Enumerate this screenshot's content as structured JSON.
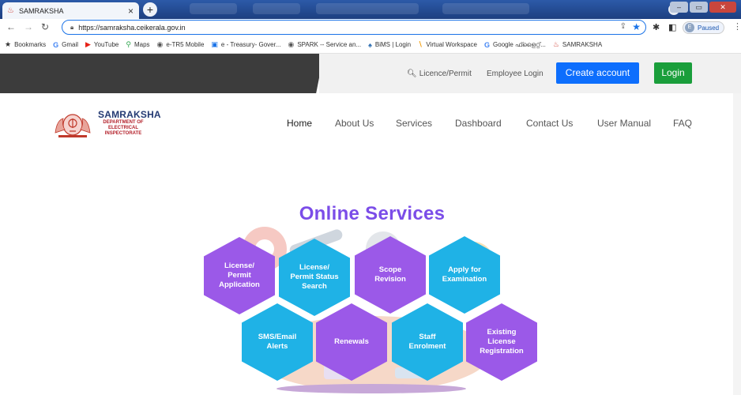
{
  "browser": {
    "tab_title": "SAMRAKSHA",
    "url": "https://samraksha.ceikerala.gov.in",
    "profile_status": "Paused",
    "profile_initial": "E",
    "bookmarks": [
      {
        "icon": "★",
        "label": "Bookmarks"
      },
      {
        "icon": "G",
        "label": "Gmail"
      },
      {
        "icon": "▶",
        "label": "YouTube"
      },
      {
        "icon": "⚲",
        "label": "Maps"
      },
      {
        "icon": "◉",
        "label": "e-TR5 Mobile"
      },
      {
        "icon": "▣",
        "label": "e - Treasury- Gover..."
      },
      {
        "icon": "◉",
        "label": "SPARK -- Service an..."
      },
      {
        "icon": "♠",
        "label": "BiMS | Login"
      },
      {
        "icon": "∖",
        "label": "Virtual Workspace"
      },
      {
        "icon": "G",
        "label": "Google ഫ്ളൈറ്റ്..."
      },
      {
        "icon": "♨",
        "label": "SAMRAKSHA"
      }
    ]
  },
  "header": {
    "search_link": "Licence/Permit",
    "employee_login": "Employee Login",
    "create_account": "Create account",
    "login": "Login"
  },
  "logo": {
    "title": "SAMRAKSHA",
    "subtitle": "DEPARTMENT OF ELECTRICAL INSPECTORATE"
  },
  "nav": {
    "items": [
      "Home",
      "About Us",
      "Services",
      "Dashboard",
      "Contact Us",
      "User Manual",
      "FAQ"
    ]
  },
  "services": {
    "title": "Online Services",
    "tiles": [
      {
        "label": "License/\nPermit\nApplication",
        "color": "#9b59e8"
      },
      {
        "label": "License/\nPermit Status\nSearch",
        "color": "#1fb2e6"
      },
      {
        "label": "Scope\nRevision",
        "color": "#9b59e8"
      },
      {
        "label": "Apply for\nExamination",
        "color": "#1fb2e6"
      },
      {
        "label": "SMS/Email\nAlerts",
        "color": "#1fb2e6"
      },
      {
        "label": "Renewals",
        "color": "#9b59e8"
      },
      {
        "label": "Staff\nEnrolment",
        "color": "#1fb2e6"
      },
      {
        "label": "Existing\nLicense\nRegistration",
        "color": "#9b59e8"
      }
    ]
  }
}
